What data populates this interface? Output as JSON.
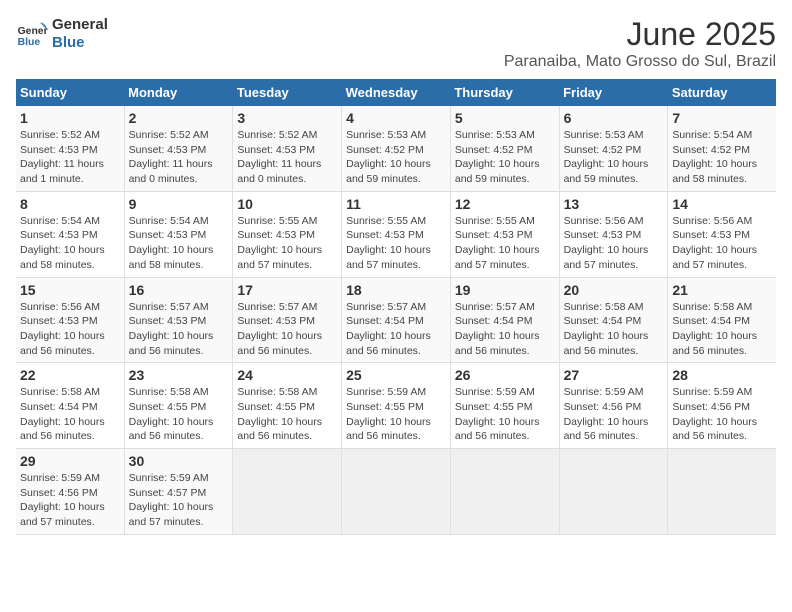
{
  "logo": {
    "line1": "General",
    "line2": "Blue"
  },
  "title": "June 2025",
  "subtitle": "Paranaiba, Mato Grosso do Sul, Brazil",
  "header": {
    "save_label": "June 2025",
    "location_label": "Paranaiba, Mato Grosso do Sul, Brazil"
  },
  "weekdays": [
    "Sunday",
    "Monday",
    "Tuesday",
    "Wednesday",
    "Thursday",
    "Friday",
    "Saturday"
  ],
  "weeks": [
    [
      {
        "day": 1,
        "info": "Sunrise: 5:52 AM\nSunset: 4:53 PM\nDaylight: 11 hours\nand 1 minute."
      },
      {
        "day": 2,
        "info": "Sunrise: 5:52 AM\nSunset: 4:53 PM\nDaylight: 11 hours\nand 0 minutes."
      },
      {
        "day": 3,
        "info": "Sunrise: 5:52 AM\nSunset: 4:53 PM\nDaylight: 11 hours\nand 0 minutes."
      },
      {
        "day": 4,
        "info": "Sunrise: 5:53 AM\nSunset: 4:52 PM\nDaylight: 10 hours\nand 59 minutes."
      },
      {
        "day": 5,
        "info": "Sunrise: 5:53 AM\nSunset: 4:52 PM\nDaylight: 10 hours\nand 59 minutes."
      },
      {
        "day": 6,
        "info": "Sunrise: 5:53 AM\nSunset: 4:52 PM\nDaylight: 10 hours\nand 59 minutes."
      },
      {
        "day": 7,
        "info": "Sunrise: 5:54 AM\nSunset: 4:52 PM\nDaylight: 10 hours\nand 58 minutes."
      }
    ],
    [
      {
        "day": 8,
        "info": "Sunrise: 5:54 AM\nSunset: 4:53 PM\nDaylight: 10 hours\nand 58 minutes."
      },
      {
        "day": 9,
        "info": "Sunrise: 5:54 AM\nSunset: 4:53 PM\nDaylight: 10 hours\nand 58 minutes."
      },
      {
        "day": 10,
        "info": "Sunrise: 5:55 AM\nSunset: 4:53 PM\nDaylight: 10 hours\nand 57 minutes."
      },
      {
        "day": 11,
        "info": "Sunrise: 5:55 AM\nSunset: 4:53 PM\nDaylight: 10 hours\nand 57 minutes."
      },
      {
        "day": 12,
        "info": "Sunrise: 5:55 AM\nSunset: 4:53 PM\nDaylight: 10 hours\nand 57 minutes."
      },
      {
        "day": 13,
        "info": "Sunrise: 5:56 AM\nSunset: 4:53 PM\nDaylight: 10 hours\nand 57 minutes."
      },
      {
        "day": 14,
        "info": "Sunrise: 5:56 AM\nSunset: 4:53 PM\nDaylight: 10 hours\nand 57 minutes."
      }
    ],
    [
      {
        "day": 15,
        "info": "Sunrise: 5:56 AM\nSunset: 4:53 PM\nDaylight: 10 hours\nand 56 minutes."
      },
      {
        "day": 16,
        "info": "Sunrise: 5:57 AM\nSunset: 4:53 PM\nDaylight: 10 hours\nand 56 minutes."
      },
      {
        "day": 17,
        "info": "Sunrise: 5:57 AM\nSunset: 4:53 PM\nDaylight: 10 hours\nand 56 minutes."
      },
      {
        "day": 18,
        "info": "Sunrise: 5:57 AM\nSunset: 4:54 PM\nDaylight: 10 hours\nand 56 minutes."
      },
      {
        "day": 19,
        "info": "Sunrise: 5:57 AM\nSunset: 4:54 PM\nDaylight: 10 hours\nand 56 minutes."
      },
      {
        "day": 20,
        "info": "Sunrise: 5:58 AM\nSunset: 4:54 PM\nDaylight: 10 hours\nand 56 minutes."
      },
      {
        "day": 21,
        "info": "Sunrise: 5:58 AM\nSunset: 4:54 PM\nDaylight: 10 hours\nand 56 minutes."
      }
    ],
    [
      {
        "day": 22,
        "info": "Sunrise: 5:58 AM\nSunset: 4:54 PM\nDaylight: 10 hours\nand 56 minutes."
      },
      {
        "day": 23,
        "info": "Sunrise: 5:58 AM\nSunset: 4:55 PM\nDaylight: 10 hours\nand 56 minutes."
      },
      {
        "day": 24,
        "info": "Sunrise: 5:58 AM\nSunset: 4:55 PM\nDaylight: 10 hours\nand 56 minutes."
      },
      {
        "day": 25,
        "info": "Sunrise: 5:59 AM\nSunset: 4:55 PM\nDaylight: 10 hours\nand 56 minutes."
      },
      {
        "day": 26,
        "info": "Sunrise: 5:59 AM\nSunset: 4:55 PM\nDaylight: 10 hours\nand 56 minutes."
      },
      {
        "day": 27,
        "info": "Sunrise: 5:59 AM\nSunset: 4:56 PM\nDaylight: 10 hours\nand 56 minutes."
      },
      {
        "day": 28,
        "info": "Sunrise: 5:59 AM\nSunset: 4:56 PM\nDaylight: 10 hours\nand 56 minutes."
      }
    ],
    [
      {
        "day": 29,
        "info": "Sunrise: 5:59 AM\nSunset: 4:56 PM\nDaylight: 10 hours\nand 57 minutes."
      },
      {
        "day": 30,
        "info": "Sunrise: 5:59 AM\nSunset: 4:57 PM\nDaylight: 10 hours\nand 57 minutes."
      },
      null,
      null,
      null,
      null,
      null
    ]
  ]
}
